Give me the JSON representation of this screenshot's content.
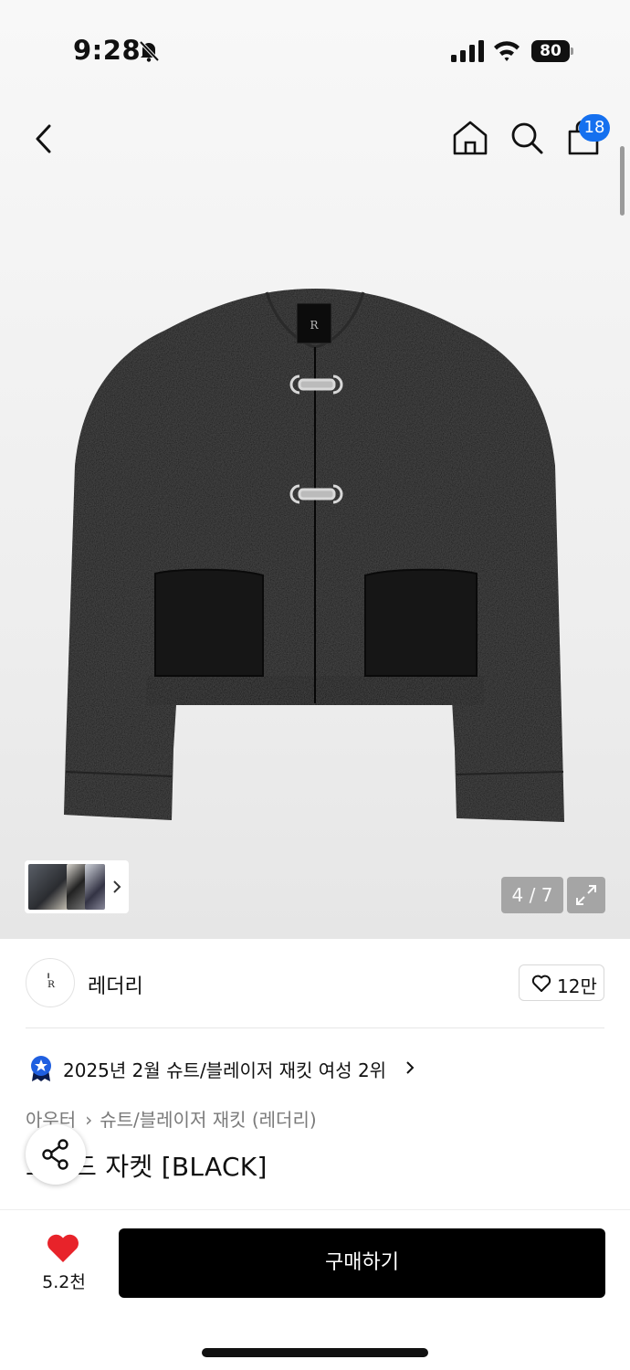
{
  "status_bar": {
    "time": "9:28",
    "battery": "80"
  },
  "nav": {
    "cart_count": "18"
  },
  "gallery": {
    "counter": "4 / 7"
  },
  "store": {
    "name": "레더리",
    "logo_text": "LEATHERY",
    "likes": "12만"
  },
  "ranking": {
    "text": "2025년 2월 슈트/블레이저 재킷 여성 2위"
  },
  "breadcrumb": {
    "category": "아우터",
    "subcategory": "슈트/블레이저 재킷 (레더리)"
  },
  "product": {
    "title": "트위드 자켓 [BLACK]"
  },
  "bottom": {
    "wish_count": "5.2천",
    "buy_label": "구매하기"
  },
  "colors": {
    "accent": "#1570ef",
    "heart": "#e8232a",
    "buy_button": "#000000"
  },
  "icons": [
    "bell-slash-icon",
    "signal-icon",
    "wifi-icon",
    "back-icon",
    "home-icon",
    "search-icon",
    "bag-icon",
    "chevron-right-icon",
    "expand-icon",
    "heart-outline-icon",
    "rank-badge-icon",
    "share-icon",
    "heart-filled-icon"
  ]
}
